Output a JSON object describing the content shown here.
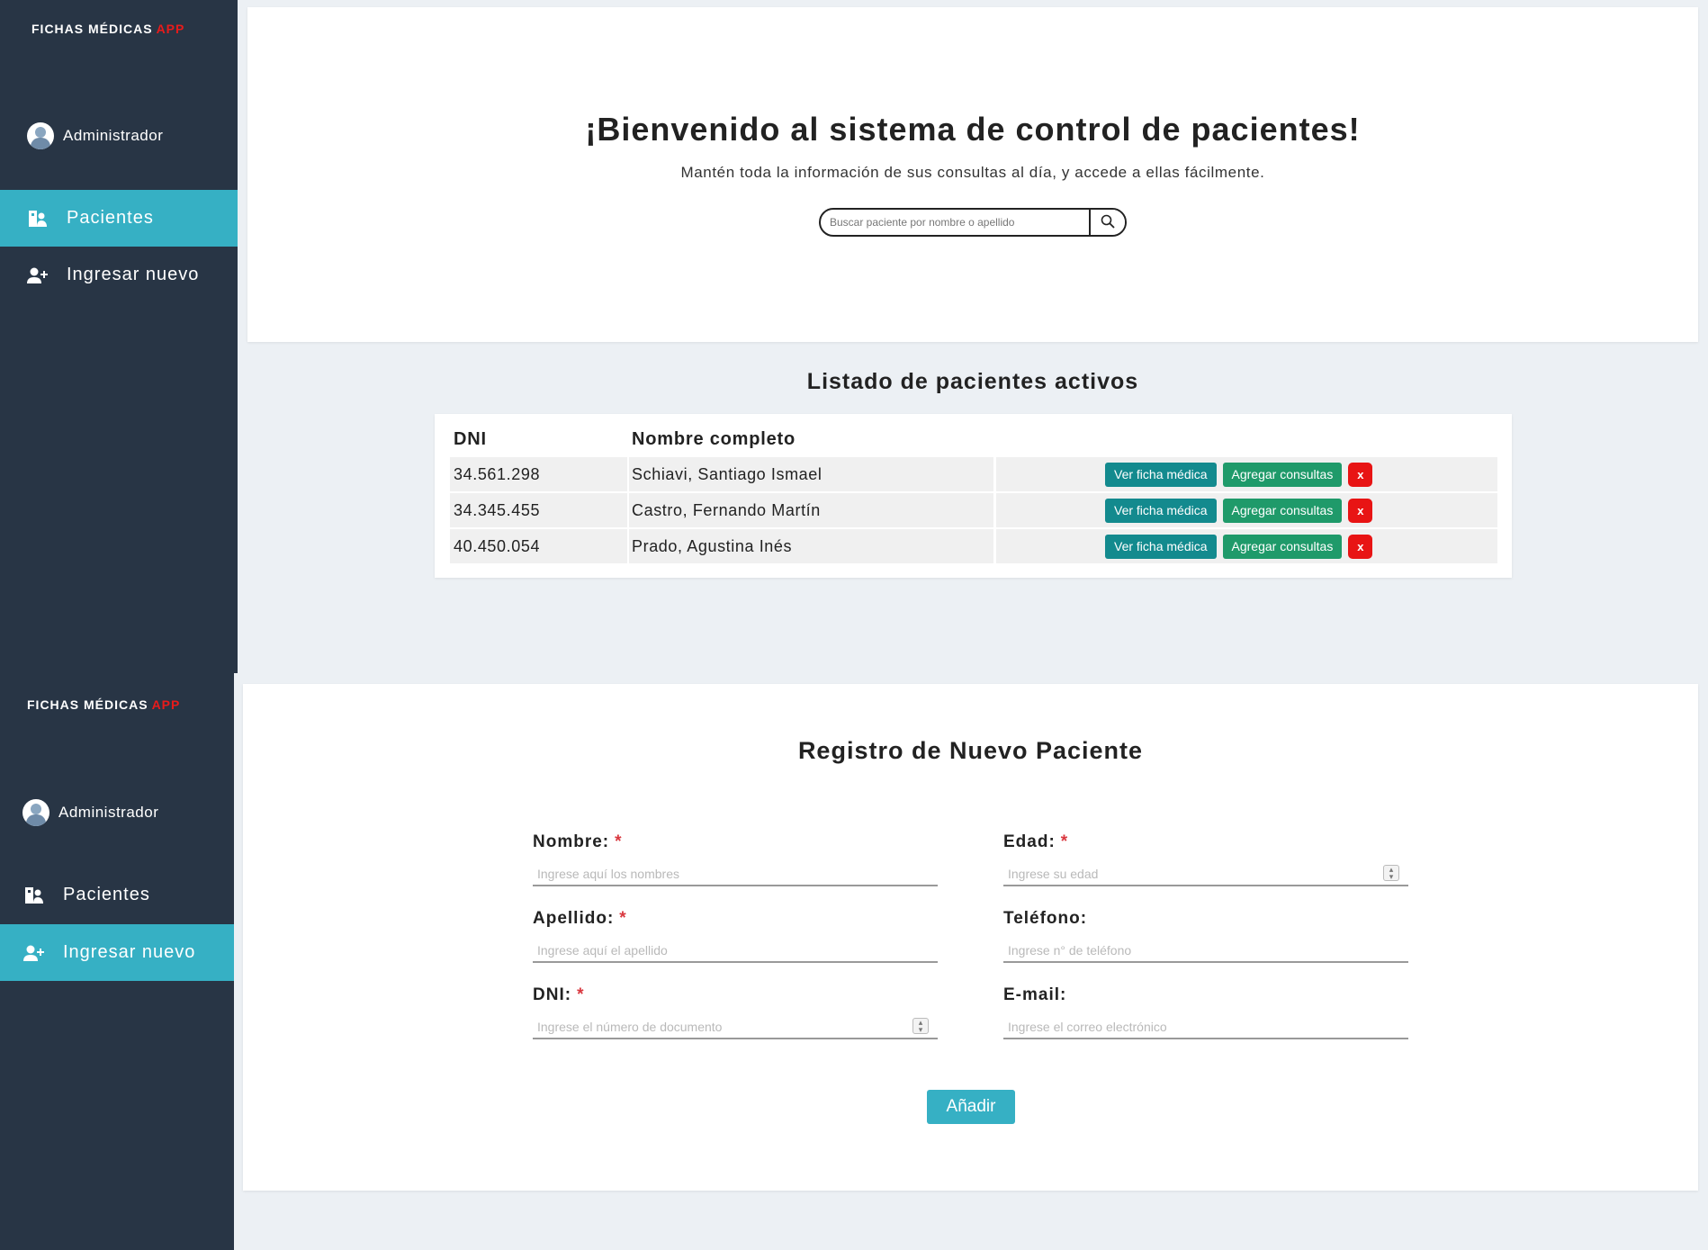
{
  "app": {
    "brand": "FICHAS MÉDICAS",
    "brand_accent": "APP"
  },
  "sidebar": {
    "user": "Administrador",
    "items": [
      {
        "label": "Pacientes",
        "icon": "hospital-user-icon"
      },
      {
        "label": "Ingresar nuevo",
        "icon": "user-plus-icon"
      }
    ]
  },
  "hero": {
    "title": "¡Bienvenido al sistema de control de pacientes!",
    "subtitle": "Mantén toda la información de sus consultas al día, y accede a ellas fácilmente.",
    "search_placeholder": "Buscar paciente por nombre o apellido"
  },
  "patients": {
    "title": "Listado de pacientes activos",
    "columns": [
      "DNI",
      "Nombre completo"
    ],
    "rows": [
      {
        "dni": "34.561.298",
        "name": "Schiavi, Santiago Ismael"
      },
      {
        "dni": "34.345.455",
        "name": "Castro, Fernando Martín"
      },
      {
        "dni": "40.450.054",
        "name": "Prado, Agustina Inés"
      }
    ],
    "actions": {
      "view": "Ver ficha médica",
      "add": "Agregar consultas",
      "delete": "x"
    }
  },
  "form": {
    "title": "Registro de Nuevo Paciente",
    "fields": {
      "nombre": {
        "label": "Nombre:",
        "placeholder": "Ingrese aquí los nombres"
      },
      "edad": {
        "label": "Edad:",
        "placeholder": "Ingrese su edad"
      },
      "apellido": {
        "label": "Apellido:",
        "placeholder": "Ingrese aquí el apellido"
      },
      "telefono": {
        "label": "Teléfono:",
        "placeholder": "Ingrese n° de teléfono"
      },
      "dni": {
        "label": "DNI:",
        "placeholder": "Ingrese el número de documento"
      },
      "email": {
        "label": "E-mail:",
        "placeholder": "Ingrese el correo electrónico"
      }
    },
    "required_mark": "*",
    "submit": "Añadir"
  },
  "colors": {
    "sidebar": "#283545",
    "accent": "#36b0c4",
    "brand_accent": "#e81b1b",
    "view_btn": "#138a8e",
    "add_btn": "#1f9a6a",
    "delete_btn": "#e81414"
  }
}
